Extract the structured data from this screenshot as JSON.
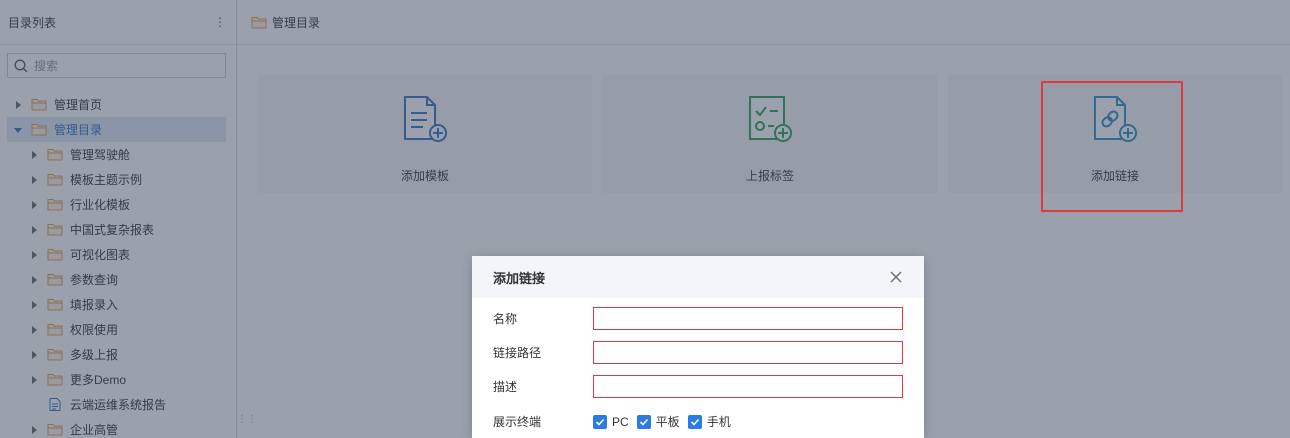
{
  "sidebar": {
    "title": "目录列表",
    "more_icon": "⋮",
    "search_placeholder": "搜索",
    "items": [
      {
        "label": "管理首页",
        "level": 0,
        "type": "folder",
        "expanded": false
      },
      {
        "label": "管理目录",
        "level": 0,
        "type": "folder",
        "expanded": true,
        "selected": true
      },
      {
        "label": "管理驾驶舱",
        "level": 1,
        "type": "folder"
      },
      {
        "label": "模板主题示例",
        "level": 1,
        "type": "folder"
      },
      {
        "label": "行业化模板",
        "level": 1,
        "type": "folder"
      },
      {
        "label": "中国式复杂报表",
        "level": 1,
        "type": "folder"
      },
      {
        "label": "可视化图表",
        "level": 1,
        "type": "folder"
      },
      {
        "label": "参数查询",
        "level": 1,
        "type": "folder"
      },
      {
        "label": "填报录入",
        "level": 1,
        "type": "folder"
      },
      {
        "label": "权限使用",
        "level": 1,
        "type": "folder"
      },
      {
        "label": "多级上报",
        "level": 1,
        "type": "folder"
      },
      {
        "label": "更多Demo",
        "level": 1,
        "type": "folder"
      },
      {
        "label": "云端运维系统报告",
        "level": 1,
        "type": "file"
      },
      {
        "label": "企业高管",
        "level": 1,
        "type": "folder"
      }
    ]
  },
  "breadcrumb": {
    "label": "管理目录"
  },
  "cards": [
    {
      "label": "添加模板",
      "icon": "add-template-icon",
      "color": "#3a6fc4"
    },
    {
      "label": "上报标签",
      "icon": "report-tag-icon",
      "color": "#2e9e5b"
    },
    {
      "label": "添加链接",
      "icon": "add-link-icon",
      "color": "#2a8fc9"
    }
  ],
  "dialog": {
    "title": "添加链接",
    "fields": [
      {
        "label": "名称",
        "value": ""
      },
      {
        "label": "链接路径",
        "value": ""
      },
      {
        "label": "描述",
        "value": ""
      }
    ],
    "terminal_label": "展示终端",
    "terminals": [
      {
        "label": "PC",
        "checked": true
      },
      {
        "label": "平板",
        "checked": true
      },
      {
        "label": "手机",
        "checked": true
      }
    ]
  },
  "colors": {
    "folder": "#e39a4c",
    "selected_bg": "#dce8f7",
    "accent": "#2c7be5",
    "error_border": "#e4393c"
  }
}
